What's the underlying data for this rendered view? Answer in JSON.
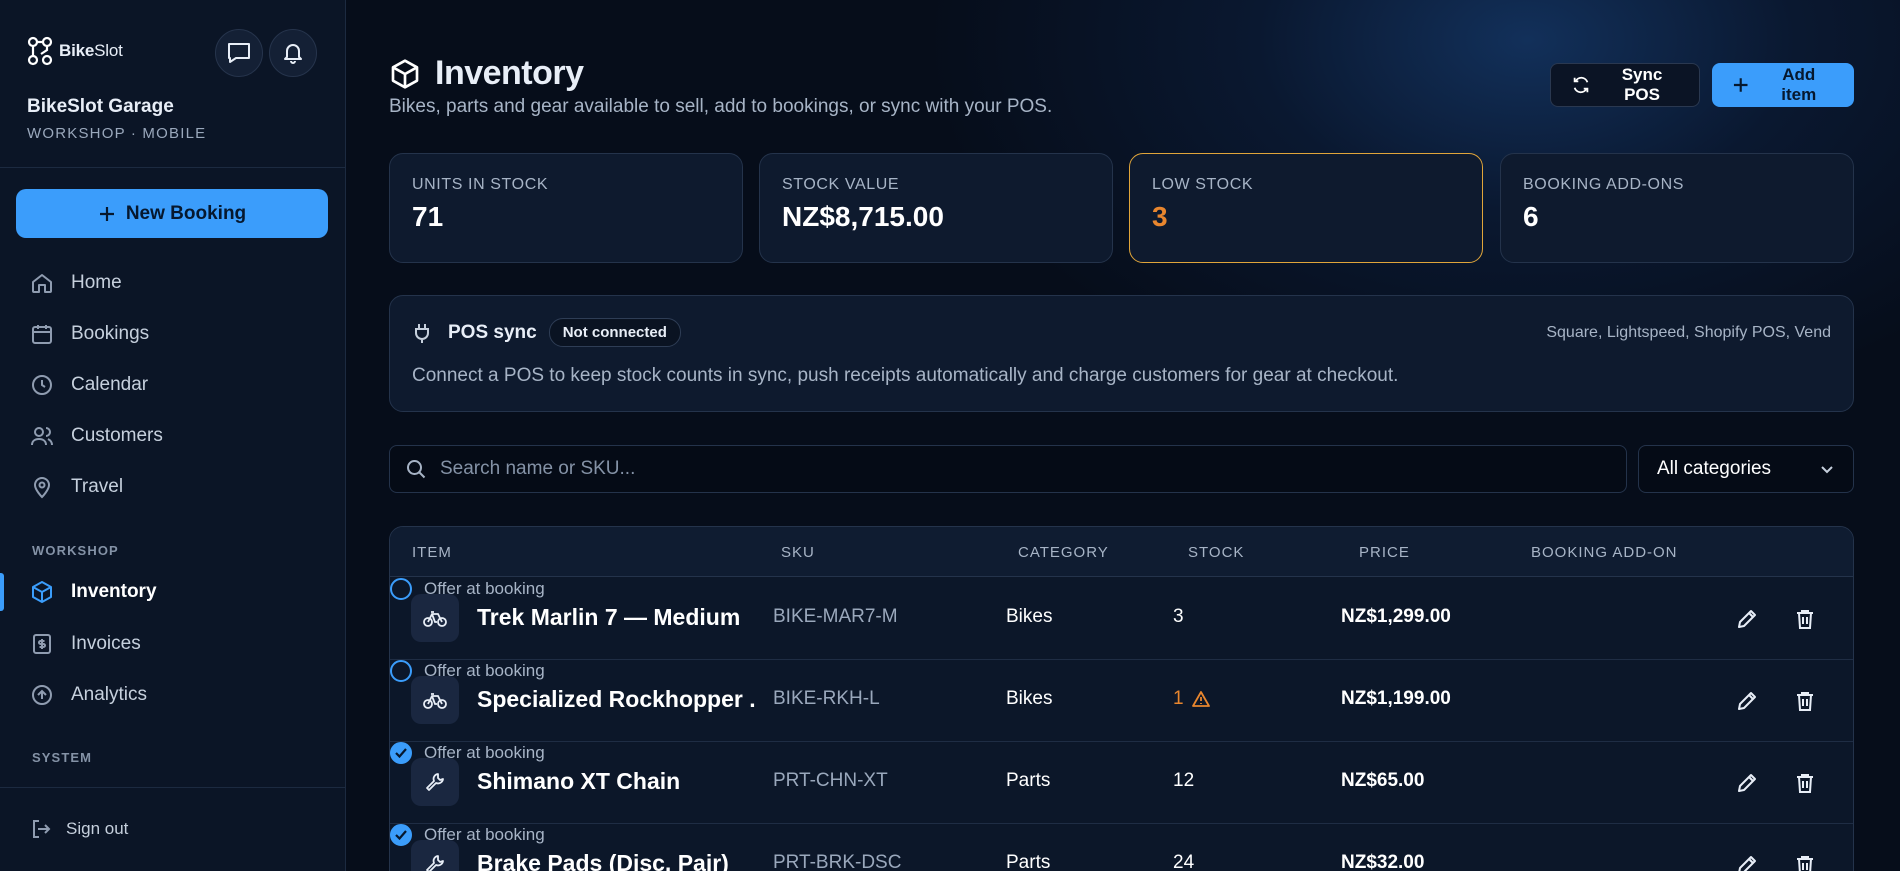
{
  "sidebar": {
    "brand_bold": "Bike",
    "brand_light": "Slot",
    "garage_name": "BikeSlot Garage",
    "garage_sub": "WORKSHOP · MOBILE",
    "new_booking": "New Booking",
    "nav": [
      {
        "label": "Home",
        "icon": "home-icon"
      },
      {
        "label": "Bookings",
        "icon": "calendar-icon"
      },
      {
        "label": "Calendar",
        "icon": "clock-icon"
      },
      {
        "label": "Customers",
        "icon": "users-icon"
      },
      {
        "label": "Travel",
        "icon": "map-pin-icon"
      }
    ],
    "workshop_label": "WORKSHOP",
    "workshop_nav": [
      {
        "label": "Inventory",
        "icon": "box-icon",
        "active": true
      },
      {
        "label": "Invoices",
        "icon": "receipt-icon"
      },
      {
        "label": "Analytics",
        "icon": "arrow-up-circle-icon"
      }
    ],
    "system_label": "SYSTEM",
    "sign_out": "Sign out"
  },
  "header": {
    "title": "Inventory",
    "subtitle": "Bikes, parts and gear available to sell, add to bookings, or sync with your POS.",
    "sync_label": "Sync POS",
    "add_label": "Add item"
  },
  "stats": [
    {
      "label": "UNITS IN STOCK",
      "value": "71"
    },
    {
      "label": "STOCK VALUE",
      "value": "NZ$8,715.00"
    },
    {
      "label": "LOW STOCK",
      "value": "3"
    },
    {
      "label": "BOOKING ADD-ONS",
      "value": "6"
    }
  ],
  "pos": {
    "title": "POS sync",
    "badge": "Not connected",
    "providers": "Square, Lightspeed, Shopify POS, Vend",
    "description": "Connect a POS to keep stock counts in sync, push receipts automatically and charge customers for gear at checkout."
  },
  "search": {
    "placeholder": "Search name or SKU...",
    "value": ""
  },
  "category_filter": {
    "selected": "All categories"
  },
  "table": {
    "columns": [
      "ITEM",
      "SKU",
      "CATEGORY",
      "STOCK",
      "PRICE",
      "BOOKING ADD-ON"
    ],
    "rows": [
      {
        "name": "Trek Marlin 7 — Medium",
        "sku": "BIKE-MAR7-M",
        "category": "Bikes",
        "stock": "3",
        "low": false,
        "price": "NZ$1,299.00",
        "addon": "Offer at booking",
        "addon_on": false,
        "icon": "bike-icon"
      },
      {
        "name": "Specialized Rockhopper ...",
        "sku": "BIKE-RKH-L",
        "category": "Bikes",
        "stock": "1",
        "low": true,
        "price": "NZ$1,199.00",
        "addon": "Offer at booking",
        "addon_on": false,
        "icon": "bike-icon"
      },
      {
        "name": "Shimano XT Chain",
        "sku": "PRT-CHN-XT",
        "category": "Parts",
        "stock": "12",
        "low": false,
        "price": "NZ$65.00",
        "addon": "Offer at booking",
        "addon_on": true,
        "icon": "wrench-icon"
      },
      {
        "name": "Brake Pads (Disc, Pair)",
        "sku": "PRT-BRK-DSC",
        "category": "Parts",
        "stock": "24",
        "low": false,
        "price": "NZ$32.00",
        "addon": "Offer at booking",
        "addon_on": true,
        "icon": "wrench-icon"
      }
    ]
  },
  "colors": {
    "accent": "#3b9dfb",
    "warning": "#e8862e",
    "warning_border": "#e0a53a",
    "background": "#060d1a"
  }
}
